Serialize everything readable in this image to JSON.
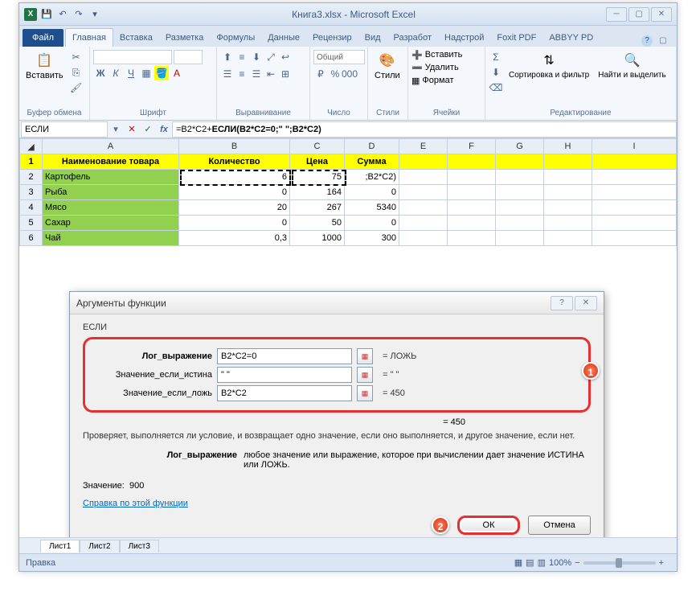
{
  "title": "Книга3.xlsx - Microsoft Excel",
  "file_tab": "Файл",
  "tabs": [
    "Главная",
    "Вставка",
    "Разметка",
    "Формулы",
    "Данные",
    "Рецензир",
    "Вид",
    "Разработ",
    "Надстрой",
    "Foxit PDF",
    "ABBYY PD"
  ],
  "ribbon": {
    "paste": "Вставить",
    "g_clipboard": "Буфер обмена",
    "g_font": "Шрифт",
    "g_align": "Выравнивание",
    "g_number": "Число",
    "g_styles": "Стили",
    "g_cells": "Ячейки",
    "g_edit": "Редактирование",
    "numfmt": "Общий",
    "styles": "Стили",
    "insert": "Вставить",
    "delete": "Удалить",
    "format": "Формат",
    "sort": "Сортировка и фильтр",
    "find": "Найти и выделить"
  },
  "namebox": "ЕСЛИ",
  "formula_pre": "=B2*C2+",
  "formula_fn": "ЕСЛИ(B2*C2=0;\" \";B2*C2)",
  "cols": [
    "A",
    "B",
    "C",
    "D",
    "E",
    "F",
    "G",
    "H",
    "I"
  ],
  "headers": {
    "a": "Наименование товара",
    "b": "Количество",
    "c": "Цена",
    "d": "Сумма"
  },
  "rows": [
    {
      "n": "1"
    },
    {
      "n": "2",
      "a": "Картофель",
      "b": "6",
      "c": "75",
      "d": ";B2*C2)"
    },
    {
      "n": "3",
      "a": "Рыба",
      "b": "0",
      "c": "164",
      "d": "0"
    },
    {
      "n": "4",
      "a": "Мясо",
      "b": "20",
      "c": "267",
      "d": "5340"
    },
    {
      "n": "5",
      "a": "Сахар",
      "b": "0",
      "c": "50",
      "d": "0"
    },
    {
      "n": "6",
      "a": "Чай",
      "b": "0,3",
      "c": "1000",
      "d": "300"
    }
  ],
  "dialog": {
    "title": "Аргументы функции",
    "fn": "ЕСЛИ",
    "arg1_lbl": "Лог_выражение",
    "arg1_val": "B2*C2=0",
    "arg1_res": "= ЛОЖЬ",
    "arg2_lbl": "Значение_если_истина",
    "arg2_val": "\" \"",
    "arg2_res": "= \" \"",
    "arg3_lbl": "Значение_если_ложь",
    "arg3_val": "B2*C2",
    "arg3_res": "= 450",
    "fres": "= 450",
    "desc": "Проверяет, выполняется ли условие, и возвращает одно значение, если оно выполняется, и другое значение, если нет.",
    "argdesc_l": "Лог_выражение",
    "argdesc_r": "любое значение или выражение, которое при вычислении дает значение ИСТИНА или ЛОЖЬ.",
    "value_lbl": "Значение:",
    "value": "900",
    "help": "Справка по этой функции",
    "ok": "ОК",
    "cancel": "Отмена"
  },
  "sheet_tabs": [
    "Лист1",
    "Лист2",
    "Лист3"
  ],
  "status": "Правка",
  "zoom": "100%"
}
